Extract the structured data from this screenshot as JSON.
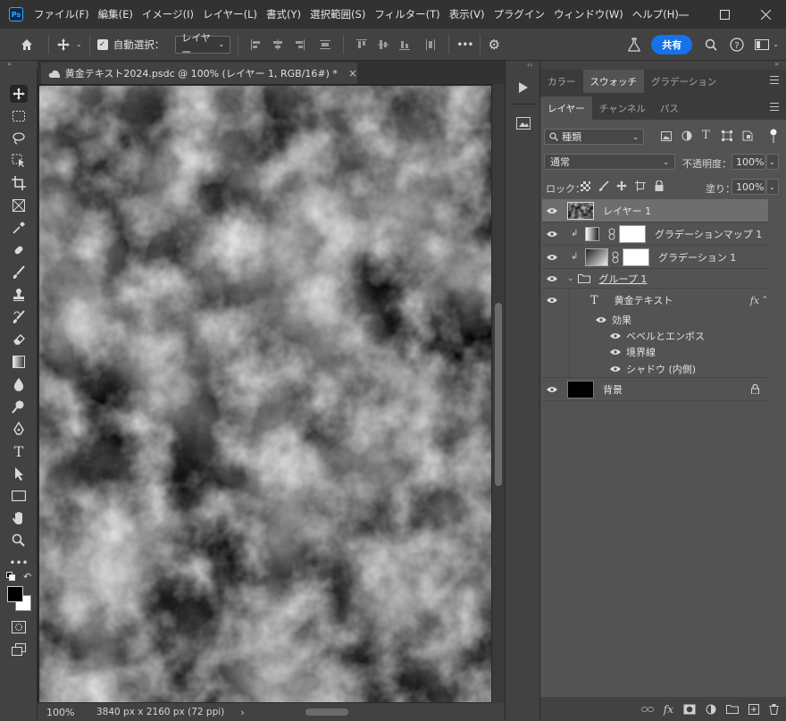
{
  "menubar": {
    "logo": "Ps",
    "items": [
      "ファイル(F)",
      "編集(E)",
      "イメージ(I)",
      "レイヤー(L)",
      "書式(Y)",
      "選択範囲(S)",
      "フィルター(T)",
      "表示(V)",
      "プラグイン",
      "ウィンドウ(W)",
      "ヘルプ(H)"
    ],
    "window_controls": [
      "minimize-icon",
      "maximize-icon",
      "close-icon"
    ]
  },
  "options_bar": {
    "auto_select_label": "自動選択：",
    "auto_select_checked": true,
    "target": "レイヤー",
    "more": "•••",
    "share_label": "共有"
  },
  "toolbar": {
    "collapse": "»",
    "tools": [
      "move-tool",
      "marquee-tool",
      "lasso-tool",
      "object-select-tool",
      "crop-tool",
      "frame-tool",
      "eyedropper-tool",
      "healing-brush-tool",
      "brush-tool",
      "clone-stamp-tool",
      "history-brush-tool",
      "eraser-tool",
      "gradient-tool",
      "blur-tool",
      "dodge-tool",
      "pen-tool",
      "type-tool",
      "path-select-tool",
      "rectangle-tool",
      "hand-tool",
      "zoom-tool",
      "more-tools"
    ],
    "foreground_color": "#000000",
    "background_color": "#ffffff"
  },
  "document": {
    "tab_title": "黄金テキスト2024.psdc @ 100% (レイヤー 1, RGB/16#) *",
    "close": "×",
    "zoom": "100%",
    "doc_info": "3840 px x 2160 px (72 ppi)",
    "status_arrow": "›"
  },
  "panels": {
    "collapse_left": "‹‹",
    "collapse_right": "»",
    "top_tabs": [
      "カラー",
      "スウォッチ",
      "グラデーション"
    ],
    "top_active": 1,
    "layer_tabs": [
      "レイヤー",
      "チャンネル",
      "パス"
    ],
    "layer_active": 0,
    "filter_label": "種類",
    "blend_mode": "通常",
    "opacity_label": "不透明度：",
    "opacity_value": "100%",
    "lock_label": "ロック：",
    "fill_label": "塗り：",
    "fill_value": "100%"
  },
  "layers": [
    {
      "name": "レイヤー 1",
      "type": "pixel",
      "selected": true
    },
    {
      "name": "グラデーションマップ 1",
      "type": "adjustment",
      "clipped": true
    },
    {
      "name": "グラデーション 1",
      "type": "fill",
      "clipped": true
    },
    {
      "name": "グループ 1",
      "type": "group",
      "expanded": true
    },
    {
      "name": "黄金テキスト",
      "type": "text",
      "fx": "fx",
      "effects_label": "効果",
      "effects": [
        "ベベルとエンボス",
        "境界線",
        "シャドウ (内側)"
      ]
    },
    {
      "name": "背景",
      "type": "background",
      "locked": true
    }
  ],
  "layer_actions": [
    "link-icon",
    "fx-icon",
    "mask-icon",
    "adjustment-icon",
    "group-folder-icon",
    "new-layer-icon",
    "trash-icon"
  ]
}
